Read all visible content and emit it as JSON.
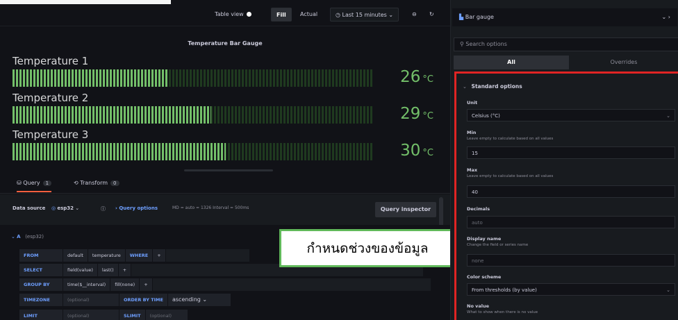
{
  "toolbar": {
    "table_view": "Table view",
    "fill": "Fill",
    "actual": "Actual",
    "time_range": "Last 15 minutes"
  },
  "panel": {
    "title": "Temperature Bar Gauge",
    "gauges": [
      {
        "label": "Temperature 1",
        "value": "26",
        "unit": "°C",
        "fill_fraction": 0.43
      },
      {
        "label": "Temperature 2",
        "value": "29",
        "unit": "°C",
        "fill_fraction": 0.55
      },
      {
        "label": "Temperature 3",
        "value": "30",
        "unit": "°C",
        "fill_fraction": 0.59
      }
    ]
  },
  "query_tabs": {
    "query": "Query",
    "query_count": "1",
    "transform": "Transform",
    "transform_count": "0"
  },
  "datasource": {
    "label": "Data source",
    "name": "esp32",
    "query_options": "Query options",
    "meta": "MD = auto = 1326   Interval = 500ms",
    "inspector": "Query inspector"
  },
  "query": {
    "ref": "A",
    "ds": "(esp32)",
    "from_kw": "FROM",
    "from_policy": "default",
    "from_measurement": "temperature",
    "where_kw": "WHERE",
    "plus": "+",
    "select_kw": "SELECT",
    "select_field": "field(value)",
    "select_fn": "last()",
    "groupby_kw": "GROUP BY",
    "groupby_time": "time($__interval)",
    "groupby_fill": "fill(none)",
    "timezone_kw": "TIMEZONE",
    "timezone_value": "(optional)",
    "orderby_kw": "ORDER BY TIME",
    "orderby_value": "ascending",
    "limit_kw": "LIMIT",
    "limit_value": "(optional)",
    "slimit_kw": "SLIMIT",
    "slimit_value": "(optional)"
  },
  "callout": {
    "text": "กำหนดช่วงของข้อมูล"
  },
  "options": {
    "viz_name": "Bar gauge",
    "search_placeholder": "Search options",
    "tab_all": "All",
    "tab_overrides": "Overrides",
    "section_title": "Standard options",
    "unit_label": "Unit",
    "unit_value": "Celsius (°C)",
    "min_label": "Min",
    "min_desc": "Leave empty to calculate based on all values",
    "min_value": "15",
    "max_label": "Max",
    "max_desc": "Leave empty to calculate based on all values",
    "max_value": "40",
    "decimals_label": "Decimals",
    "decimals_placeholder": "auto",
    "display_name_label": "Display name",
    "display_name_desc": "Change the field or series name",
    "display_name_placeholder": "none",
    "color_scheme_label": "Color scheme",
    "color_scheme_value": "From thresholds (by value)",
    "no_value_label": "No value",
    "no_value_desc": "What to show when there is no value"
  },
  "colors": {
    "gauge_green": "#73bf69",
    "highlight_red": "#e02424",
    "callout_border": "#60b85a",
    "link_blue": "#6e9fff"
  }
}
